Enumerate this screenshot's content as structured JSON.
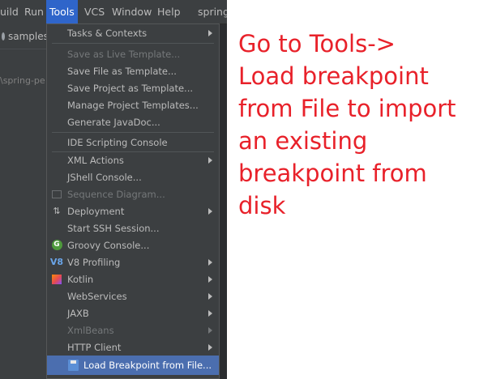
{
  "menubar": {
    "items": [
      {
        "label": "uild",
        "active": false
      },
      {
        "label": "Run",
        "active": false
      },
      {
        "label": "Tools",
        "active": true
      },
      {
        "label": "VCS",
        "active": false
      },
      {
        "label": "Window",
        "active": false
      },
      {
        "label": "Help",
        "active": false
      },
      {
        "label": "spring",
        "active": false
      }
    ]
  },
  "sidebar": {
    "tab_label": "samples",
    "path_text": "\\spring-pe"
  },
  "tools_menu": {
    "items": [
      {
        "label": "Tasks & Contexts",
        "submenu": true,
        "disabled": false
      },
      {
        "label": "Save as Live Template...",
        "disabled": true
      },
      {
        "label": "Save File as Template...",
        "disabled": false
      },
      {
        "label": "Save Project as Template...",
        "disabled": false
      },
      {
        "label": "Manage Project Templates...",
        "disabled": false
      },
      {
        "label": "Generate JavaDoc...",
        "disabled": false
      },
      {
        "label": "IDE Scripting Console",
        "disabled": false
      },
      {
        "label": "XML Actions",
        "submenu": true,
        "disabled": false
      },
      {
        "label": "JShell Console...",
        "disabled": false
      },
      {
        "label": "Sequence Diagram...",
        "disabled": true,
        "icon": "sequence-diagram-icon"
      },
      {
        "label": "Deployment",
        "submenu": true,
        "disabled": false,
        "icon": "deployment-icon"
      },
      {
        "label": "Start SSH Session...",
        "disabled": false
      },
      {
        "label": "Groovy Console...",
        "disabled": false,
        "icon": "groovy-icon"
      },
      {
        "label": "V8 Profiling",
        "submenu": true,
        "disabled": false,
        "icon": "v8-icon"
      },
      {
        "label": "Kotlin",
        "submenu": true,
        "disabled": false,
        "icon": "kotlin-icon"
      },
      {
        "label": "WebServices",
        "submenu": true,
        "disabled": false
      },
      {
        "label": "JAXB",
        "submenu": true,
        "disabled": false
      },
      {
        "label": "XmlBeans",
        "submenu": true,
        "disabled": true
      },
      {
        "label": "HTTP Client",
        "submenu": true,
        "disabled": false
      },
      {
        "label": "Load Breakpoint from File...",
        "selected": true,
        "icon": "floppy-disk-icon"
      }
    ],
    "selected_color": "#4b6eaf"
  },
  "annotation": {
    "lines": [
      "Go to Tools->",
      "Load breakpoint",
      "from File to import",
      "an existing",
      "breakpoint from",
      "disk"
    ],
    "color": "#e8212a"
  }
}
